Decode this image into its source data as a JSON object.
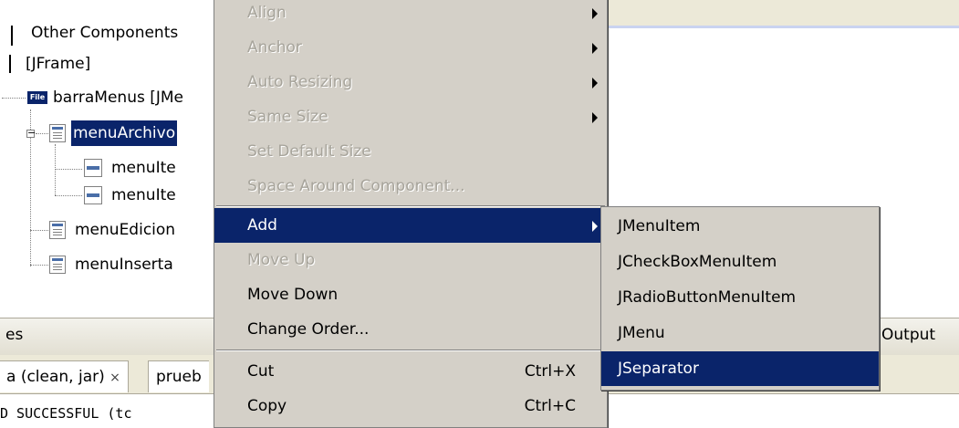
{
  "navigator": {
    "items": [
      {
        "label": "Other Components"
      },
      {
        "label": "[JFrame]"
      },
      {
        "label": "barraMenus [JMe"
      },
      {
        "label": "menuArchivo"
      },
      {
        "label": "menuIte"
      },
      {
        "label": "menuIte"
      },
      {
        "label": "menuEdicion"
      },
      {
        "label": "menuInserta"
      }
    ],
    "file_badge": "File"
  },
  "bottom_panel": {
    "header_left": "es",
    "output_tab": "Output",
    "tabs": [
      {
        "label": "a (clean, jar)",
        "close": "×"
      },
      {
        "label": "prueb"
      }
    ],
    "console_text": "D SUCCESSFUL (tc"
  },
  "context_menu": {
    "items": [
      {
        "label": "Align",
        "enabled": false,
        "submenu": true
      },
      {
        "label": "Anchor",
        "enabled": false,
        "submenu": true
      },
      {
        "label": "Auto Resizing",
        "enabled": false,
        "submenu": true
      },
      {
        "label": "Same Size",
        "enabled": false,
        "submenu": true
      },
      {
        "label": "Set Default Size",
        "enabled": false
      },
      {
        "label": "Space Around Component...",
        "enabled": false
      },
      {
        "label": "Add",
        "enabled": true,
        "submenu": true,
        "active": true
      },
      {
        "label": "Move Up",
        "enabled": false
      },
      {
        "label": "Move Down",
        "enabled": true
      },
      {
        "label": "Change Order...",
        "enabled": true
      },
      {
        "label": "Cut",
        "enabled": true,
        "shortcut": "Ctrl+X"
      },
      {
        "label": "Copy",
        "enabled": true,
        "shortcut": "Ctrl+C"
      }
    ]
  },
  "add_submenu": {
    "items": [
      {
        "label": "JMenuItem"
      },
      {
        "label": "JCheckBoxMenuItem"
      },
      {
        "label": "JRadioButtonMenuItem"
      },
      {
        "label": "JMenu"
      },
      {
        "label": "JSeparator",
        "active": true
      }
    ]
  },
  "colors": {
    "selection": "#0a246a",
    "menu_background": "#d4d0c8",
    "disabled_text": "#a7a49b"
  }
}
